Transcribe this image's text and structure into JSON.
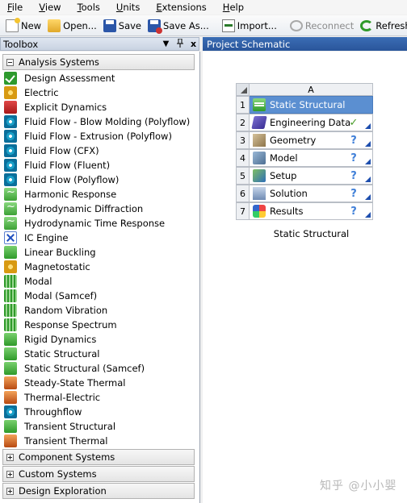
{
  "menu": [
    {
      "mnemonic": "F",
      "rest": "ile"
    },
    {
      "mnemonic": "V",
      "rest": "iew"
    },
    {
      "mnemonic": "T",
      "rest": "ools"
    },
    {
      "mnemonic": "U",
      "rest": "nits"
    },
    {
      "mnemonic": "E",
      "rest": "xtensions"
    },
    {
      "mnemonic": "H",
      "rest": "elp"
    }
  ],
  "toolbar": {
    "new": "New",
    "open": "Open...",
    "save": "Save",
    "save_as": "Save As...",
    "import": "Import...",
    "reconnect": "Reconnect",
    "refresh": "Refresh Project"
  },
  "toolbox": {
    "title": "Toolbox",
    "pin": "ᵖ",
    "close": "x",
    "analysis_systems": {
      "label": "Analysis Systems",
      "items": [
        "Design Assessment",
        "Electric",
        "Explicit Dynamics",
        "Fluid Flow - Blow Molding (Polyflow)",
        "Fluid Flow - Extrusion (Polyflow)",
        "Fluid Flow (CFX)",
        "Fluid Flow (Fluent)",
        "Fluid Flow (Polyflow)",
        "Harmonic Response",
        "Hydrodynamic Diffraction",
        "Hydrodynamic Time Response",
        "IC Engine",
        "Linear Buckling",
        "Magnetostatic",
        "Modal",
        "Modal (Samcef)",
        "Random Vibration",
        "Response Spectrum",
        "Rigid Dynamics",
        "Static Structural",
        "Static Structural (Samcef)",
        "Steady-State Thermal",
        "Thermal-Electric",
        "Throughflow",
        "Transient Structural",
        "Transient Thermal"
      ]
    },
    "component_systems": "Component Systems",
    "custom_systems": "Custom Systems",
    "design_exploration": "Design Exploration"
  },
  "schematic": {
    "title": "Project Schematic",
    "column": "A",
    "caption": "Static Structural",
    "rows": [
      {
        "num": "1",
        "label": "Static Structural",
        "status": ""
      },
      {
        "num": "2",
        "label": "Engineering Data",
        "status": "✓"
      },
      {
        "num": "3",
        "label": "Geometry",
        "status": "?"
      },
      {
        "num": "4",
        "label": "Model",
        "status": "?"
      },
      {
        "num": "5",
        "label": "Setup",
        "status": "?"
      },
      {
        "num": "6",
        "label": "Solution",
        "status": "?"
      },
      {
        "num": "7",
        "label": "Results",
        "status": "?"
      }
    ]
  },
  "watermark": "知乎 @小小婴"
}
